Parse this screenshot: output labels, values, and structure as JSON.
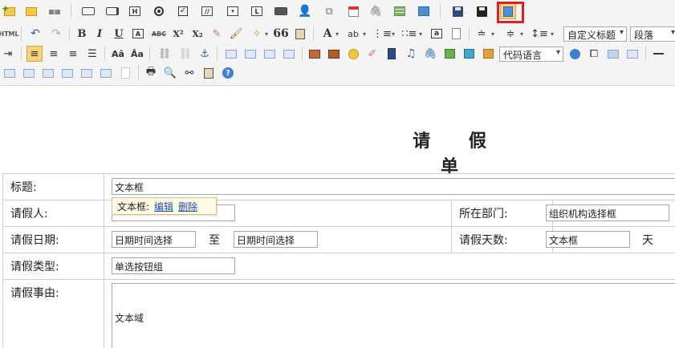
{
  "toolbar": {
    "row3_dropdowns": {
      "code_language": "代码语言"
    },
    "row2_dropdowns": {
      "custom_heading": "自定义标题",
      "paragraph": "段落"
    },
    "html_label": "HTML",
    "bold": "B",
    "italic": "I",
    "underline": "U",
    "strike": "ABC",
    "superscript": "X²",
    "subscript": "X₂",
    "quote": "66",
    "font_color": "A",
    "help": "?"
  },
  "document": {
    "title": "请 假 单",
    "rows": [
      {
        "label": "标题:"
      },
      {
        "label": "请假人:",
        "label2": "所在部门:"
      },
      {
        "label": "请假日期:",
        "label2": "请假天数:"
      },
      {
        "label": "请假类型:"
      },
      {
        "label": "请假事由:"
      }
    ],
    "fields": {
      "title_input": "文本框",
      "dept_input": "组织机构选择框",
      "start_date": "日期时间选择",
      "to_label": "至",
      "end_date": "日期时间选择",
      "days_input": "文本框",
      "days_unit": "天",
      "type_input": "单选按钮组",
      "reason_textarea": "文本域"
    },
    "popup": {
      "label": "文本框:",
      "edit": "编辑",
      "delete": "删除"
    }
  }
}
